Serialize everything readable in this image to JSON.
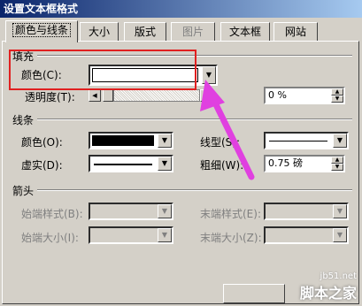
{
  "window": {
    "title": "设置文本框格式"
  },
  "tabs": [
    {
      "label": "颜色与线条",
      "active": true,
      "disabled": false
    },
    {
      "label": "大小",
      "active": false,
      "disabled": false
    },
    {
      "label": "版式",
      "active": false,
      "disabled": false
    },
    {
      "label": "图片",
      "active": false,
      "disabled": true
    },
    {
      "label": "文本框",
      "active": false,
      "disabled": false
    },
    {
      "label": "网站",
      "active": false,
      "disabled": false
    }
  ],
  "fill": {
    "group_label": "填充",
    "color_label": "颜色(C):",
    "color_value": "#ffffff",
    "transparency_label": "透明度(T):",
    "transparency_value": "0 %",
    "transparency_fraction": 0
  },
  "line": {
    "group_label": "线条",
    "color_label": "颜色(O):",
    "color_value": "#000000",
    "style_label": "线型(S):",
    "dash_label": "虚实(D):",
    "weight_label": "粗细(W):",
    "weight_value": "0.75 磅"
  },
  "arrows": {
    "group_label": "箭头",
    "begin_style_label": "始端样式(B):",
    "end_style_label": "末端样式(E):",
    "begin_size_label": "始端大小(I):",
    "end_size_label": "末端大小(Z):"
  },
  "watermark": {
    "line1": "jb51.net",
    "line2": "脚本之家"
  },
  "colors": {
    "highlight": "#e02020",
    "arrow": "#e040e0",
    "title_bar": "#0a246a"
  },
  "icons": {
    "dropdown": "chevron-down-icon",
    "spin_up": "spin-up-icon",
    "spin_down": "spin-down-icon"
  }
}
